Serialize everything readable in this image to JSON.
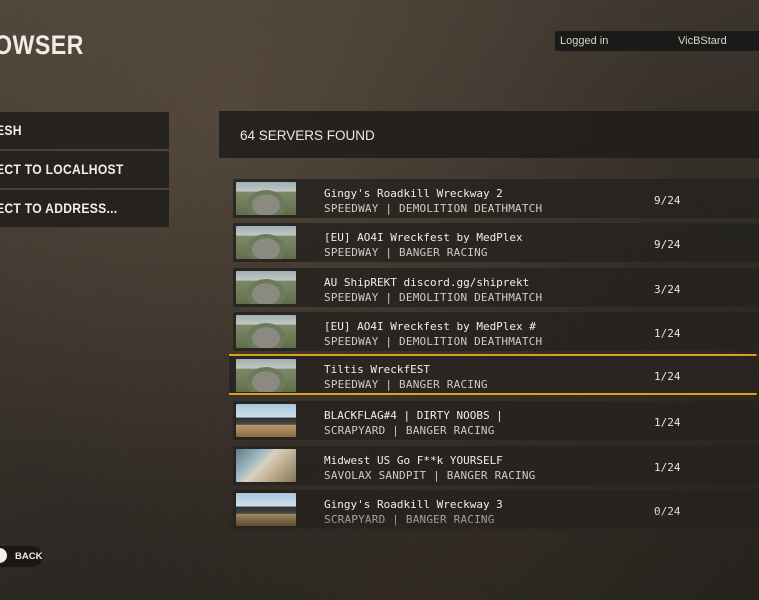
{
  "header": {
    "title": "OWSER",
    "login_label": "Logged in",
    "username": "VicBStard"
  },
  "menu": {
    "items": [
      {
        "label": "ESH"
      },
      {
        "label": "ECT TO LOCALHOST"
      },
      {
        "label": "ECT TO ADDRESS..."
      }
    ]
  },
  "server_list": {
    "count_label": "64 SERVERS FOUND",
    "servers": [
      {
        "name": "Gingy's Roadkill Wreckway 2",
        "mode": "SPEEDWAY | DEMOLITION DEATHMATCH",
        "players": "9/24",
        "thumb": "speedway"
      },
      {
        "name": "[EU]  AO4I Wreckfest by MedPlex",
        "mode": "SPEEDWAY | BANGER RACING",
        "players": "9/24",
        "thumb": "speedway"
      },
      {
        "name": "AU ShipREKT discord.gg/shiprekt",
        "mode": "SPEEDWAY | DEMOLITION DEATHMATCH",
        "players": "3/24",
        "thumb": "speedway"
      },
      {
        "name": "[EU] AO4I Wreckfest by MedPlex #",
        "mode": "SPEEDWAY | DEMOLITION DEATHMATCH",
        "players": "1/24",
        "thumb": "speedway"
      },
      {
        "name": "Tiltis WreckfEST",
        "mode": "SPEEDWAY | BANGER RACING",
        "players": "1/24",
        "thumb": "speedway",
        "selected": true
      },
      {
        "name": "BLACKFLAG#4 | DIRTY NOOBS |",
        "mode": "SCRAPYARD | BANGER RACING",
        "players": "1/24",
        "thumb": "scrapyard"
      },
      {
        "name": "Midwest US Go F**k YOURSELF",
        "mode": "SAVOLAX SANDPIT | BANGER RACING",
        "players": "1/24",
        "thumb": "savolax"
      },
      {
        "name": "Gingy's Roadkill Wreckway 3",
        "mode": "SCRAPYARD | BANGER RACING",
        "players": "0/24",
        "thumb": "scrapyard"
      }
    ]
  },
  "footer": {
    "back_label": "BACK"
  },
  "colors": {
    "selection_accent": "#d8a21a"
  }
}
